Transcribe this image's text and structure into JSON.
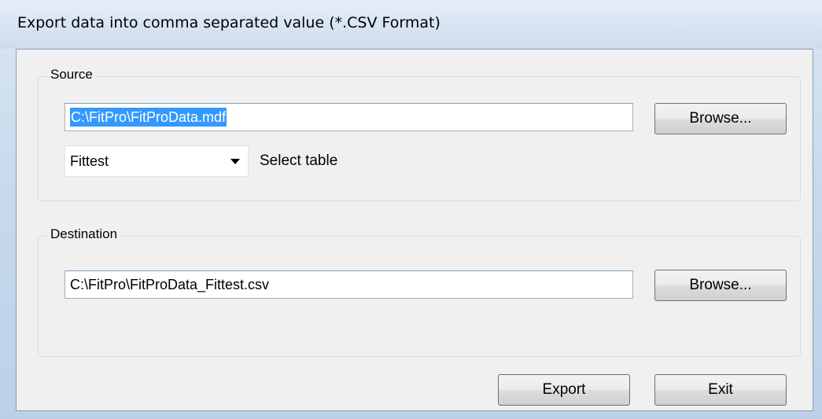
{
  "window": {
    "title": "Export data into comma separated value  (*.CSV Format)"
  },
  "source": {
    "group_label": "Source",
    "path_value": "C:\\FitPro\\FitProData.mdf",
    "browse_label": "Browse...",
    "table_selected": "Fittest",
    "table_label": "Select table"
  },
  "destination": {
    "group_label": "Destination",
    "path_value": "C:\\FitPro\\FitProData_Fittest.csv",
    "browse_label": "Browse..."
  },
  "actions": {
    "export_label": "Export",
    "exit_label": "Exit"
  },
  "icons": {
    "combo_arrow": "chevron-down-icon"
  },
  "colors": {
    "selection_highlight": "#3399ff",
    "dialog_background": "#f0f0f0"
  }
}
